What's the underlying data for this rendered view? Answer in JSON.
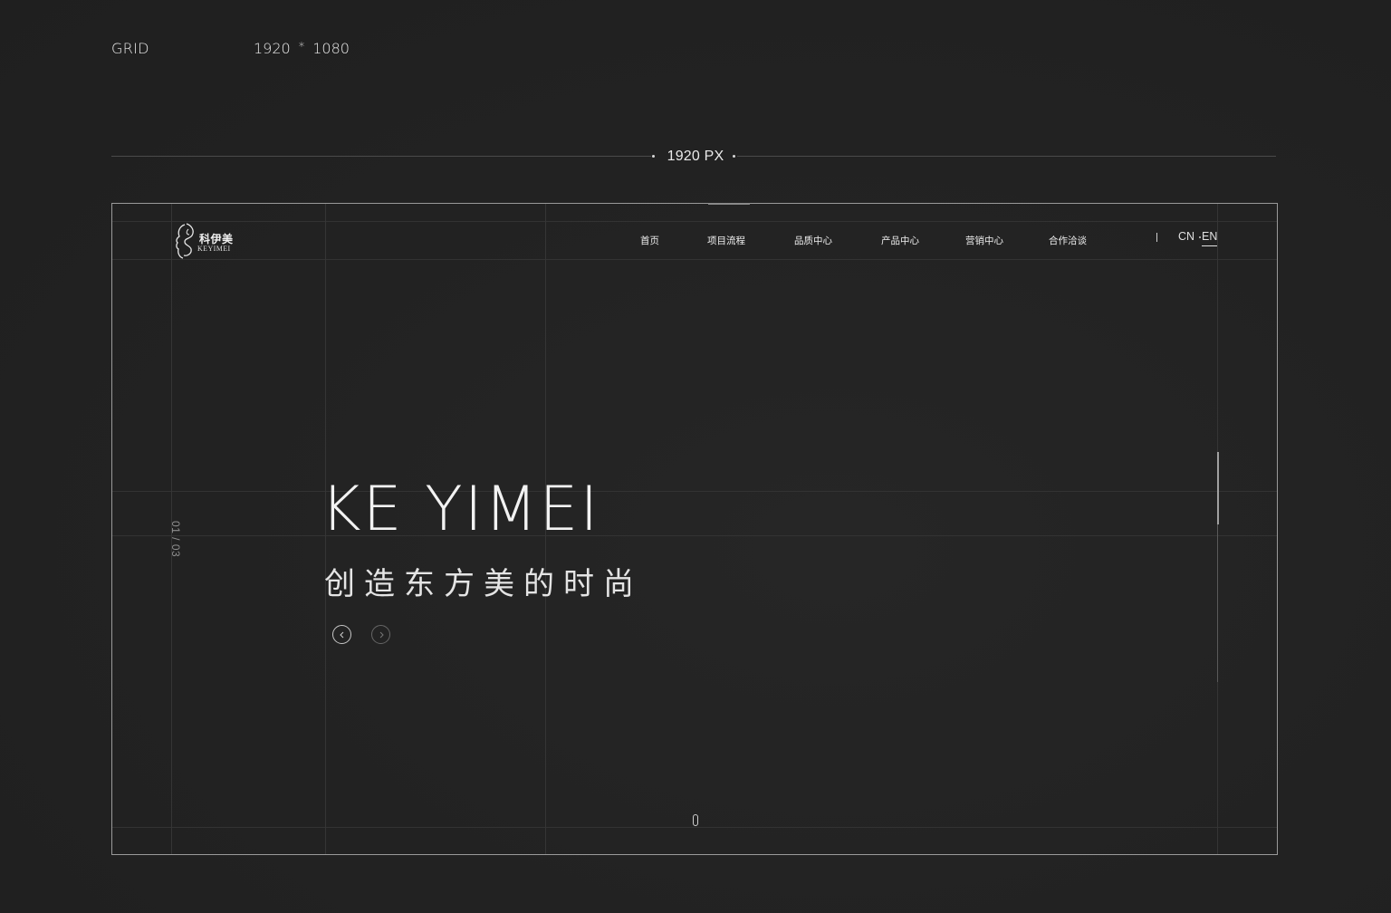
{
  "spec": {
    "grid_label": "GRID",
    "width": "1920",
    "times": "*",
    "height": "1080",
    "ruler_label": "1920 PX"
  },
  "header": {
    "logo_cn": "科伊美",
    "logo_en": "KEYIMEI",
    "nav": [
      "首页",
      "项目流程",
      "品质中心",
      "产品中心",
      "营销中心",
      "合作洽谈"
    ],
    "lang_cn": "CN",
    "lang_en": "EN"
  },
  "hero": {
    "slide_counter": "01 / 03",
    "title": "KE YIMEI",
    "subtitle": "创造东方美的时尚"
  },
  "icons": {
    "prev": "chevron-left-icon",
    "next": "chevron-right-icon",
    "scroll": "mouse-icon",
    "logo": "face-profile-icon"
  },
  "colors": {
    "background": "#222222",
    "frame_border": "#9a9a9a",
    "text": "#f2f2f2",
    "grid_line": "#333333"
  }
}
